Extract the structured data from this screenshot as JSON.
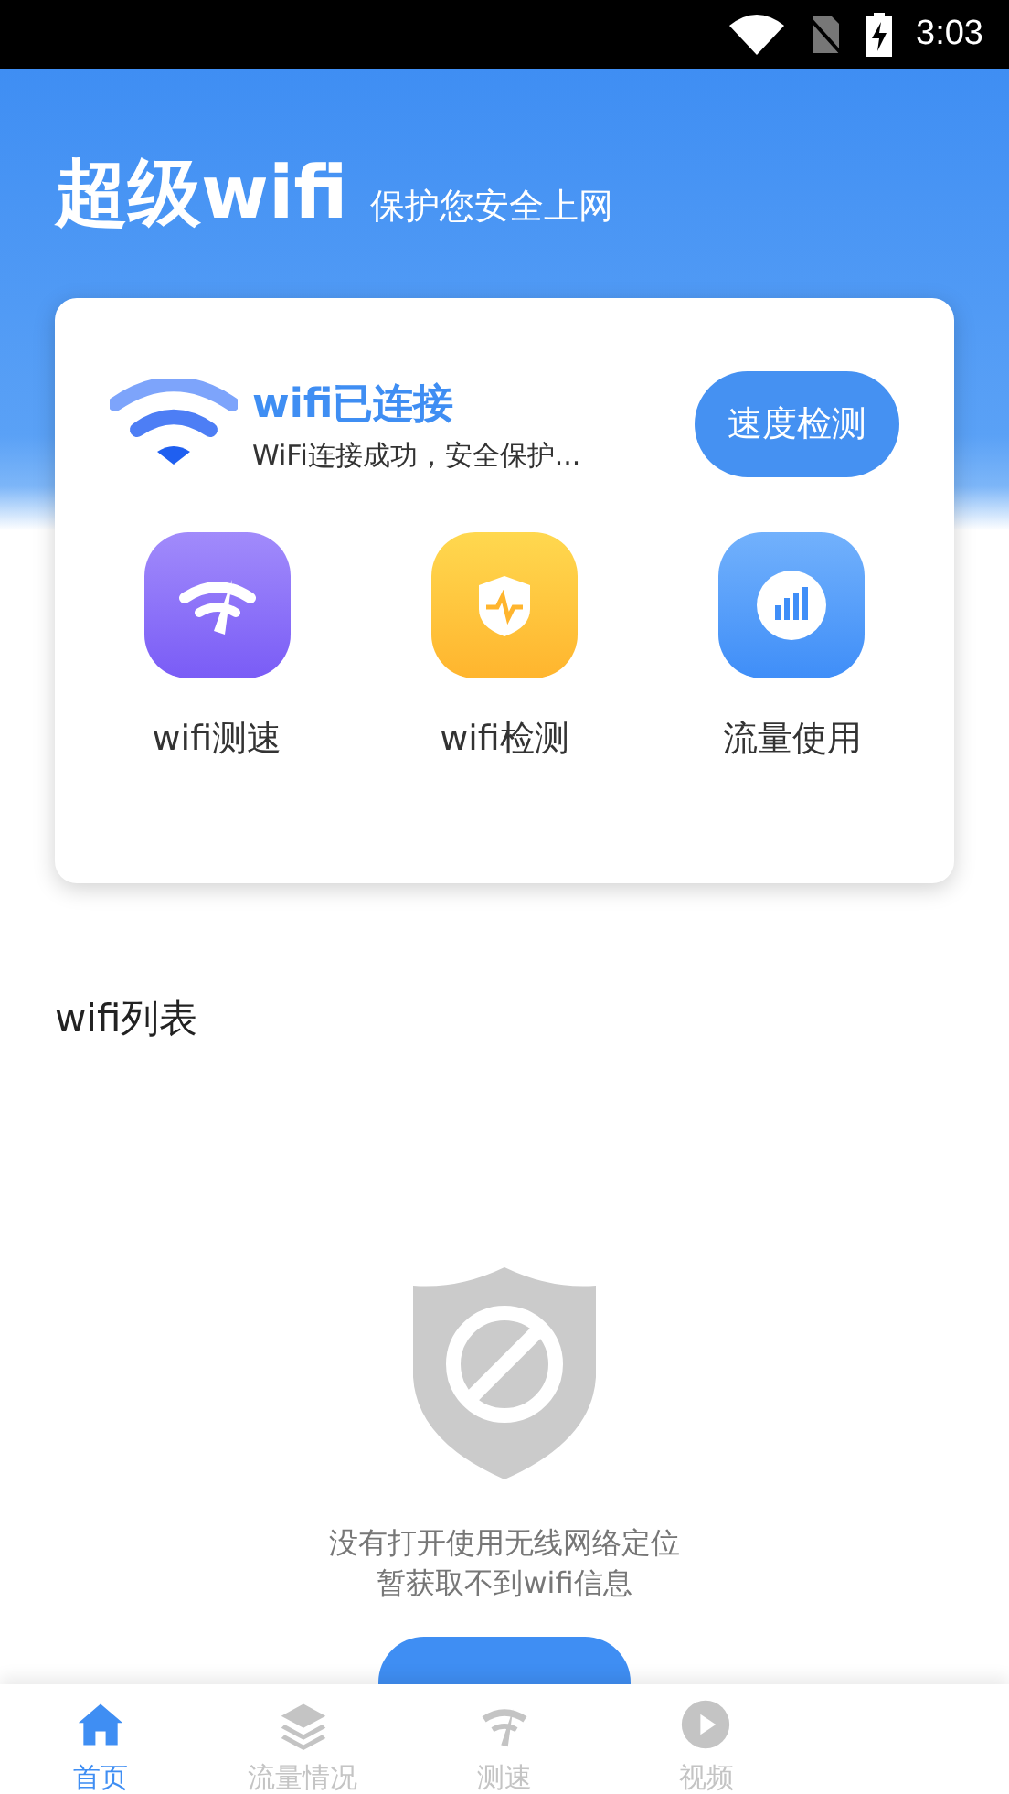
{
  "status_bar": {
    "time": "3:03"
  },
  "header": {
    "title": "超级wifi",
    "subtitle": "保护您安全上网"
  },
  "connection": {
    "title": "wifi已连接",
    "detail": "WiFi连接成功，安全保护...",
    "button": "速度检测"
  },
  "tools": [
    {
      "kind": "speed",
      "label": "wifi测速"
    },
    {
      "kind": "check",
      "label": "wifi检测"
    },
    {
      "kind": "traffic",
      "label": "流量使用"
    }
  ],
  "wifi_list": {
    "title": "wifi列表",
    "empty_lines": [
      "没有打开使用无线网络定位",
      "暂获取不到wifi信息"
    ]
  },
  "tab_bar": [
    {
      "kind": "home",
      "label": "首页",
      "selected": true
    },
    {
      "kind": "layers",
      "label": "流量情况",
      "selected": false
    },
    {
      "kind": "speed",
      "label": "测速",
      "selected": false
    },
    {
      "kind": "video",
      "label": "视频",
      "selected": false
    }
  ]
}
